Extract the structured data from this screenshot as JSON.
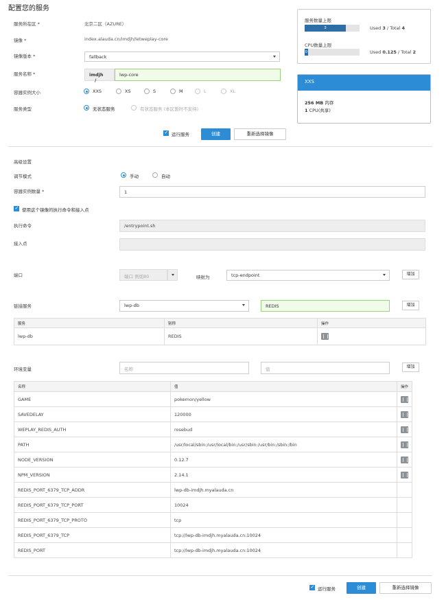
{
  "page_title": "配置您的服务",
  "labels": {
    "region": "服务所在区 *",
    "image": "镜像 *",
    "image_version": "镜像版本 *",
    "service_name": "服务名称 *",
    "container_size": "容器实例大小",
    "service_type": "服务类型"
  },
  "values": {
    "region": "北京二区（AZURE）",
    "image": "index.alauda.cn/imdjh/letweplay-core",
    "image_version": "fallback",
    "name_prefix": "imdjh",
    "name_sep": "/",
    "service_name": "lwp-core"
  },
  "sizes": [
    "XXS",
    "XS",
    "S",
    "M",
    "L",
    "XL"
  ],
  "service_types": {
    "stateless": "无状态服务",
    "stateful": "有状态服务 (本区暂时不支持)"
  },
  "quota": {
    "service_label": "服务数量上限",
    "service_bar": "3",
    "service_fill": 0.75,
    "service_used_prefix": "Used ",
    "service_used": "3",
    "service_total_sep": " / Total ",
    "service_total": "4",
    "cpu_label": "CPU数量上限",
    "cpu_bar": "0",
    "cpu_fill": 0.06,
    "cpu_used_prefix": "Used ",
    "cpu_used": "0.125",
    "cpu_total_sep": " / Total ",
    "cpu_total": "2"
  },
  "plan": {
    "name": "XXS",
    "memory_value": "256 MB",
    "memory_unit": " 内存",
    "cpu_value": "1",
    "cpu_unit": " CPU(共享)"
  },
  "actions": {
    "run_service": "运行服务",
    "create": "创建",
    "reselect_image": "重新选择镜像"
  },
  "advanced": {
    "title": "高级设置",
    "scaling_label": "调节模式",
    "manual": "手动",
    "auto": "自动",
    "instances_label": "容器实例数量 *",
    "instances": "1",
    "use_entrypoint": "使用这个镜像的执行命令和接入点",
    "command_label": "执行命令",
    "command": "/entrypoint.sh",
    "entry_label": "接入点",
    "entry": ""
  },
  "ports": {
    "label": "端口",
    "port_placeholder": "端口 例如80",
    "map_to": "映射为",
    "endpoint": "tcp-endpoint",
    "add": "增加"
  },
  "links": {
    "label": "链接服务",
    "service": "lwp-db",
    "alias": "REDIS",
    "add": "增加",
    "headers": [
      "服务",
      "别称",
      "操作"
    ],
    "rows": [
      [
        "lwp-db",
        "REDIS"
      ]
    ]
  },
  "env": {
    "label": "环境变量",
    "name_placeholder": "名称",
    "value_placeholder": "值",
    "add": "增加",
    "headers": [
      "名称",
      "值",
      "操作"
    ],
    "rows": [
      {
        "name": "GAME",
        "value": "pokemon/yellow",
        "deletable": true
      },
      {
        "name": "SAVEDELAY",
        "value": "120000",
        "deletable": true
      },
      {
        "name": "WEPLAY_REDIS_AUTH",
        "value": "rosebud",
        "deletable": true
      },
      {
        "name": "PATH",
        "value": "/usr/local/sbin:/usr/local/bin:/usr/sbin:/usr/bin:/sbin:/bin",
        "deletable": true
      },
      {
        "name": "NODE_VERSION",
        "value": "0.12.7",
        "deletable": true
      },
      {
        "name": "NPM_VERSION",
        "value": "2.14.1",
        "deletable": true
      },
      {
        "name": "REDIS_PORT_6379_TCP_ADDR",
        "value": "lwp-db-imdjh.myalauda.cn",
        "deletable": false
      },
      {
        "name": "REDIS_PORT_6379_TCP_PORT",
        "value": "10024",
        "deletable": false
      },
      {
        "name": "REDIS_PORT_6379_TCP_PROTO",
        "value": "tcp",
        "deletable": false
      },
      {
        "name": "REDIS_PORT_6379_TCP",
        "value": "tcp://lwp-db-imdjh.myalauda.cn:10024",
        "deletable": false
      },
      {
        "name": "REDIS_PORT",
        "value": "tcp://lwp-db-imdjh.myalauda.cn:10024",
        "deletable": false
      }
    ]
  },
  "colors": {
    "primary": "#2d8cd6",
    "quota_bar": "#2d6ea7",
    "valid_bg": "#f1fbe9"
  }
}
